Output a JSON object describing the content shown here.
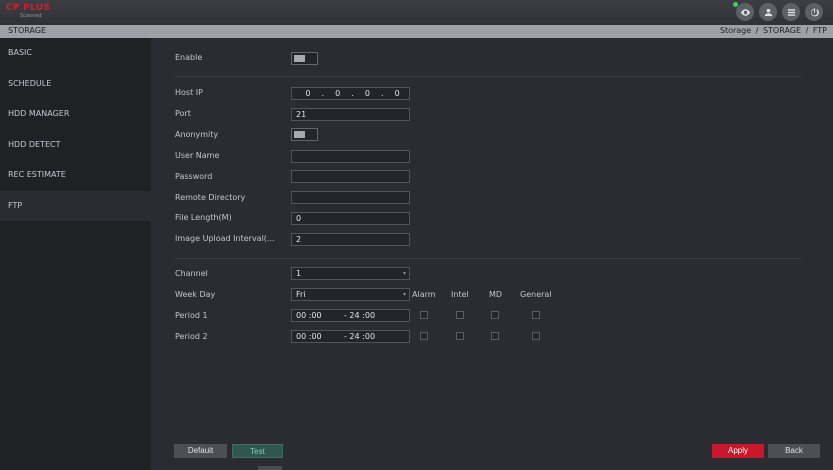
{
  "brand": {
    "name": "CP PLUS",
    "sub": "Scanned"
  },
  "header": {
    "title": "STORAGE",
    "breadcrumb": "Storage / STORAGE / FTP"
  },
  "topbar_icons": [
    "eye-icon",
    "user-icon",
    "grid-icon",
    "power-icon"
  ],
  "sidebar": {
    "items": [
      {
        "label": "BASIC"
      },
      {
        "label": "SCHEDULE"
      },
      {
        "label": "HDD MANAGER"
      },
      {
        "label": "HDD DETECT"
      },
      {
        "label": "REC ESTIMATE"
      },
      {
        "label": "FTP",
        "active": true
      }
    ]
  },
  "form": {
    "enable_label": "Enable",
    "enable_on": false,
    "host_ip_label": "Host IP",
    "host_ip": [
      "0",
      "0",
      "0",
      "0"
    ],
    "ip_dot": ".",
    "port_label": "Port",
    "port_value": "21",
    "anonymity_label": "Anonymity",
    "anonymity_on": false,
    "user_name_label": "User Name",
    "user_name_value": "",
    "password_label": "Password",
    "password_value": "",
    "remote_dir_label": "Remote Directory",
    "remote_dir_value": "",
    "file_length_label": "File Length(M)",
    "file_length_value": "0",
    "image_upload_label": "Image Upload Interval(...",
    "image_upload_value": "2",
    "channel_label": "Channel",
    "channel_value": "1",
    "week_day_label": "Week Day",
    "week_day_value": "Fri",
    "columns": [
      "Alarm",
      "Intel",
      "MD",
      "General"
    ],
    "periods": [
      {
        "label": "Period 1",
        "start": "00 :00",
        "end": "- 24 :00",
        "checks": [
          false,
          false,
          false,
          false
        ]
      },
      {
        "label": "Period 2",
        "start": "00 :00",
        "end": "- 24 :00",
        "checks": [
          false,
          false,
          false,
          false
        ]
      }
    ],
    "dropdown_arrow": "▾"
  },
  "buttons": {
    "default": "Default",
    "test": "Test",
    "apply": "Apply",
    "back": "Back"
  },
  "colors": {
    "accent": "#c8162a",
    "test_button": "#2f5650",
    "status_online": "#37d35a"
  }
}
